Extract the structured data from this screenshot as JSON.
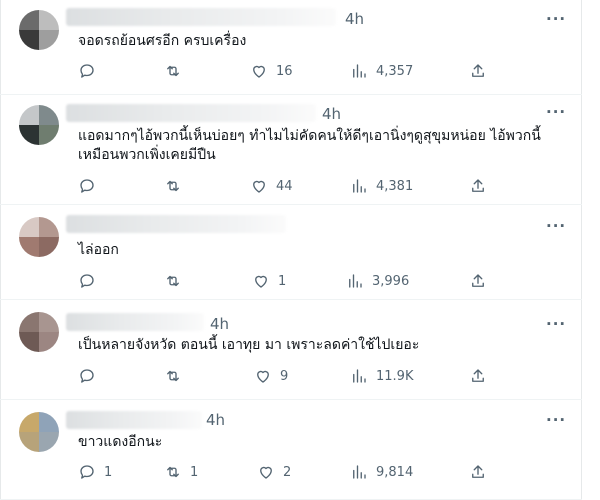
{
  "replies": [
    {
      "time": "4h",
      "text": "จอดรถย้อนศรอีก ครบเครื่อง",
      "counts": {
        "reply": "",
        "retweet": "",
        "like": "16",
        "views": "4,357"
      },
      "avatar_colors": [
        "#6b6b6b",
        "#bdbdbd",
        "#3a3a3a",
        "#9e9e9e"
      ]
    },
    {
      "time": "4h",
      "text": "แอดมากๆไอ้พวกนี้เห็นบ่อยๆ ทำไมไม่คัดคนให้ดีๆเอานิ่งๆดูสุขุมหน่อย ไอ้พวกนี้เหมือนพวกเพิ่งเคยมีปืน",
      "counts": {
        "reply": "",
        "retweet": "",
        "like": "44",
        "views": "4,381"
      },
      "avatar_colors": [
        "#c4c7c9",
        "#7f8a8c",
        "#2c3333",
        "#6f7d6f"
      ]
    },
    {
      "time": "",
      "text": "ไล่ออก",
      "counts": {
        "reply": "",
        "retweet": "",
        "like": "1",
        "views": "3,996"
      },
      "avatar_colors": [
        "#d8c9c4",
        "#b39890",
        "#a07a70",
        "#8c6a62"
      ]
    },
    {
      "time": "4h",
      "text": "เป็นหลายจังหวัด ตอนนี้ เอาทุย มา เพราะลดค่าใช้ไปเยอะ",
      "counts": {
        "reply": "",
        "retweet": "",
        "like": "9",
        "views": "11.9K"
      },
      "avatar_colors": [
        "#8a7670",
        "#a89590",
        "#6e5a55",
        "#9c8682"
      ]
    },
    {
      "time": "4h",
      "text": "ขาวแดงอีกนะ",
      "counts": {
        "reply": "1",
        "retweet": "1",
        "like": "2",
        "views": "9,814"
      },
      "avatar_colors": [
        "#c7a86a",
        "#8fa3b8",
        "#b7a37a",
        "#9aa6b0"
      ]
    }
  ],
  "more_label": "···"
}
